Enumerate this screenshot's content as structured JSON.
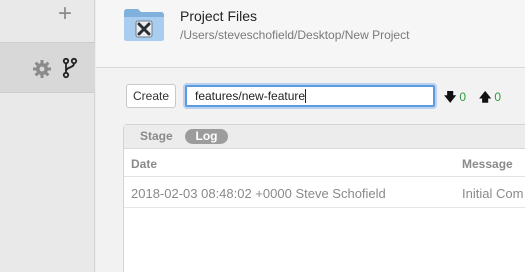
{
  "sidebar": {
    "add_icon": "plus-icon",
    "settings_icon": "gear-icon",
    "branch_icon": "git-branch-icon"
  },
  "header": {
    "project_title": "Project Files",
    "project_path": "/Users/steveschofield/Desktop/New Project",
    "folder_icon": "folder-icon"
  },
  "branch_bar": {
    "create_label": "Create",
    "branch_value": "features/new-feature",
    "behind_arrow": "🡇",
    "behind_count": "0",
    "ahead_arrow": "🡅",
    "ahead_count": "0",
    "count_color": "#2e9b3a"
  },
  "tabs": {
    "stage_label": "Stage",
    "log_label": "Log",
    "active": "Log"
  },
  "log_table": {
    "columns": [
      "Date",
      "Message"
    ],
    "rows": [
      {
        "date": "2018-02-03 08:48:02 +0000 Steve Schofield",
        "message": "Initial Com"
      }
    ]
  },
  "accent_color": "#5b9be6"
}
